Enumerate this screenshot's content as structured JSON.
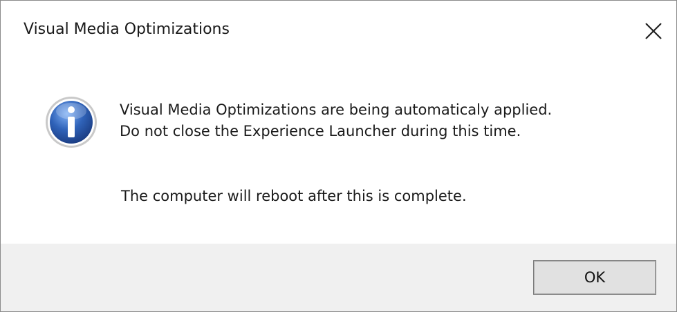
{
  "dialog": {
    "title": "Visual Media Optimizations",
    "close_icon": "close-icon",
    "info_icon": "info-icon",
    "message_line1": "Visual Media Optimizations are being automaticaly applied.",
    "message_line2": "Do not close the Experience Launcher during this time.",
    "message_line3": "The computer will reboot after this is complete.",
    "ok_label": "OK"
  },
  "colors": {
    "dialog_background": "#ffffff",
    "footer_background": "#f0f0f0",
    "button_background": "#e1e1e1",
    "info_icon_blue": "#2f62b8"
  }
}
